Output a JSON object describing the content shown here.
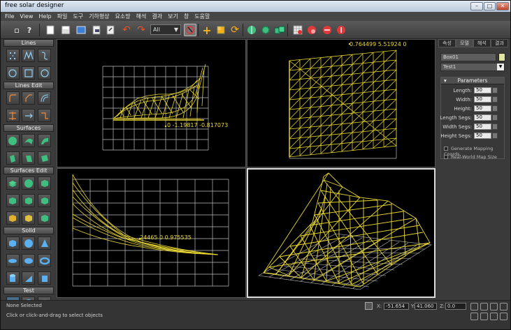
{
  "window": {
    "title": "free solar designer",
    "min_label": "–",
    "max_label": "□",
    "close_label": "✕"
  },
  "menubar": [
    "File",
    "View",
    "Help",
    "파일",
    "도구",
    "기하형상",
    "요소망",
    "해석",
    "결과",
    "보기",
    "창",
    "도움말"
  ],
  "toolbar": {
    "filter_value": "All",
    "filter_arrow": "▼"
  },
  "palette": {
    "sections": [
      "Lines",
      "Lines Edit",
      "Surfaces",
      "Surfaces Edit",
      "Solid",
      "Test"
    ]
  },
  "viewports": {
    "top_left": {
      "coord_readout": "0 -1.19817 -0.817073"
    },
    "top_right": {
      "coord_readout": "0.764499 5.51924 0"
    },
    "bottom_left": {
      "coord_readout": "24465 0 0.975535"
    }
  },
  "right_panel": {
    "tabs": [
      "속성",
      "모델",
      "해석",
      "결과"
    ],
    "object_name": "Box01",
    "object_type": "Test1",
    "params_title": "Parameters",
    "params": [
      {
        "label": "Length:",
        "value": "50"
      },
      {
        "label": "Width:",
        "value": "50"
      },
      {
        "label": "Height:",
        "value": "50"
      },
      {
        "label": "Length Segs:",
        "value": "50"
      },
      {
        "label": "Width Segs:",
        "value": "50"
      },
      {
        "label": "Height Segs:",
        "value": "50"
      }
    ],
    "checkboxes": [
      "Generate Mapping Coords.",
      "Real-World Map Size"
    ],
    "accent_color": "#e0e6a0"
  },
  "status": {
    "selection": "None Selected",
    "hint": "Click or click-and-drag to select objects",
    "x_label": "X:",
    "x_value": "-51.654",
    "y_label": "Y:",
    "y_value": "41.060",
    "z_label": "Z:",
    "z_value": "0.0"
  },
  "colors": {
    "mesh": "#ead830",
    "grid": "#bdbdbd",
    "viewport_bg": "#000000"
  }
}
